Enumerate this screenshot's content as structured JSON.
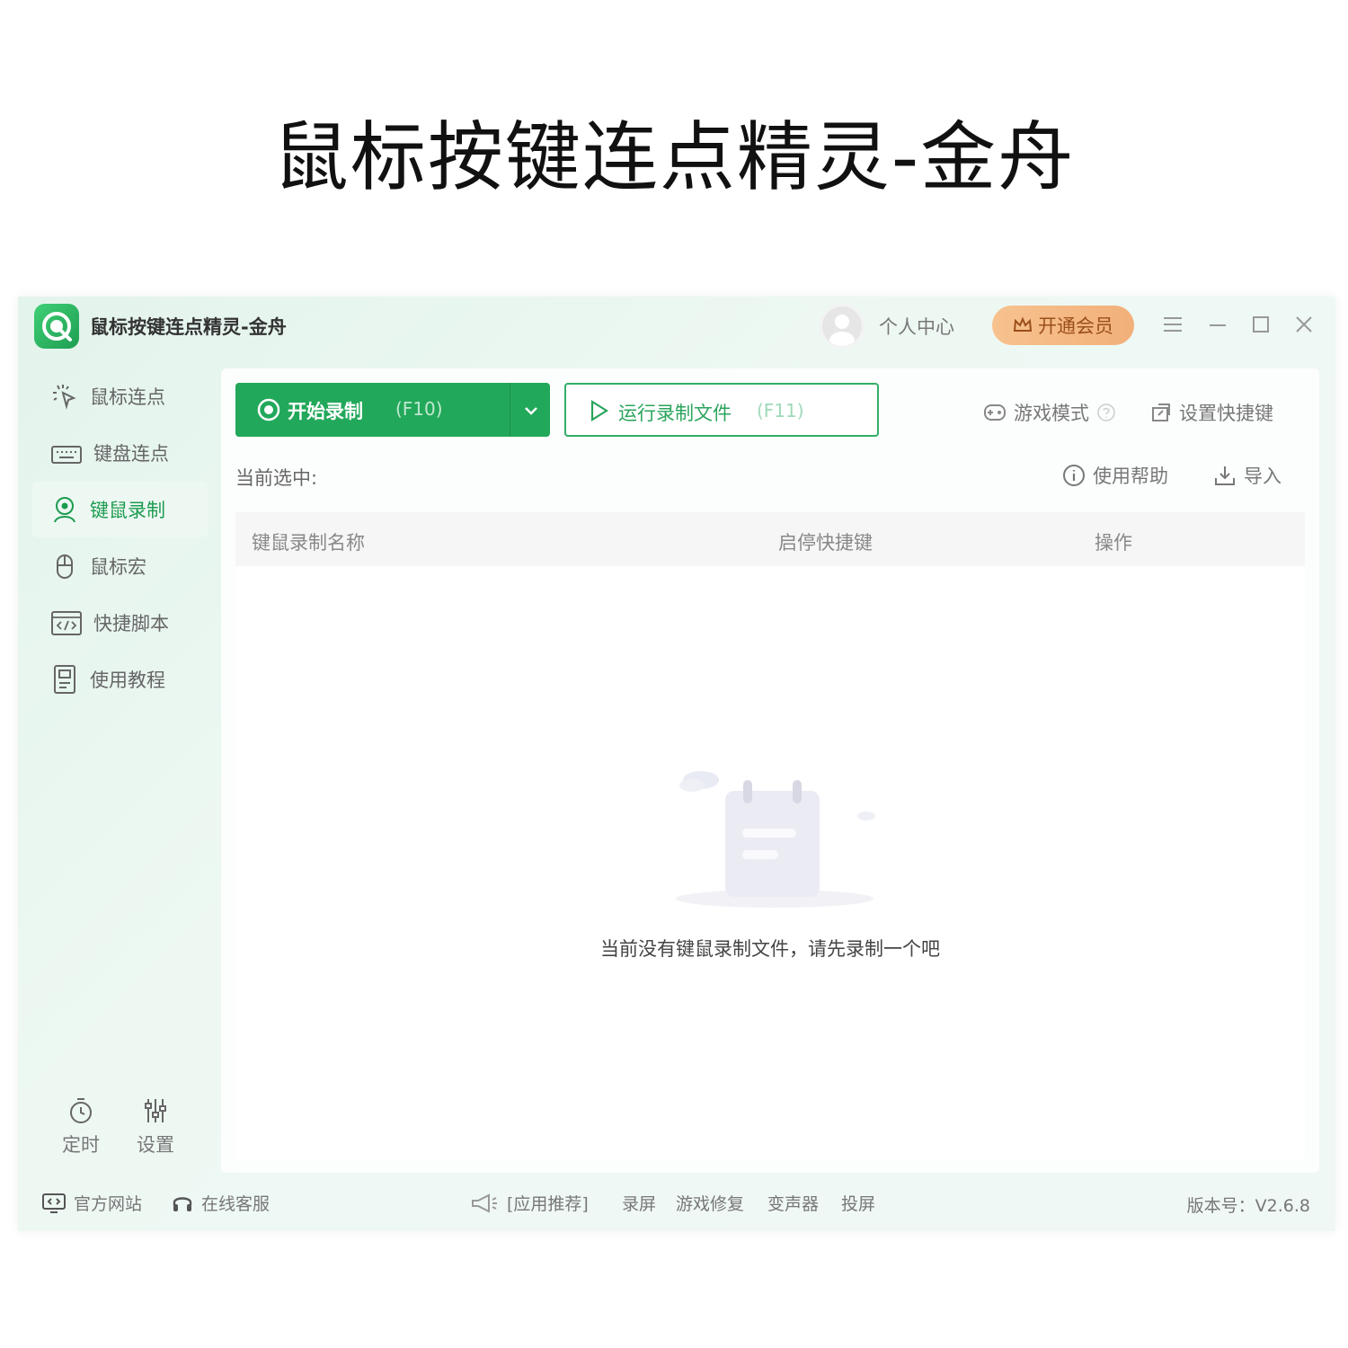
{
  "banner": {
    "title": "鼠标按键连点精灵-金舟"
  },
  "titlebar": {
    "app_name": "鼠标按键连点精灵-金舟",
    "user_center": "个人中心",
    "vip_button": "开通会员"
  },
  "sidebar": {
    "items": [
      {
        "label": "鼠标连点",
        "icon": "mouse-click-icon"
      },
      {
        "label": "键盘连点",
        "icon": "keyboard-icon"
      },
      {
        "label": "键鼠录制",
        "icon": "record-user-icon",
        "active": true
      },
      {
        "label": "鼠标宏",
        "icon": "mouse-icon"
      },
      {
        "label": "快捷脚本",
        "icon": "code-script-icon"
      },
      {
        "label": "使用教程",
        "icon": "tutorial-doc-icon"
      }
    ],
    "timer_label": "定时",
    "settings_label": "设置"
  },
  "toolbar": {
    "record_label": "开始录制",
    "record_hotkey": "(F10)",
    "run_label": "运行录制文件",
    "run_hotkey": "(F11)",
    "game_mode": "游戏模式",
    "set_shortcut": "设置快捷键",
    "help": "使用帮助",
    "import": "导入"
  },
  "main": {
    "current_selected": "当前选中:",
    "columns": [
      "键鼠录制名称",
      "启停快捷键",
      "操作"
    ],
    "empty_text": "当前没有键鼠录制文件，请先录制一个吧"
  },
  "footer": {
    "website": "官方网站",
    "support": "在线客服",
    "recommend": "[应用推荐]",
    "links": [
      "录屏",
      "游戏修复",
      "变声器",
      "投屏"
    ],
    "version": "版本号：V2.6.8"
  },
  "colors": {
    "accent": "#22a85a",
    "vip": "#f2b07a"
  }
}
